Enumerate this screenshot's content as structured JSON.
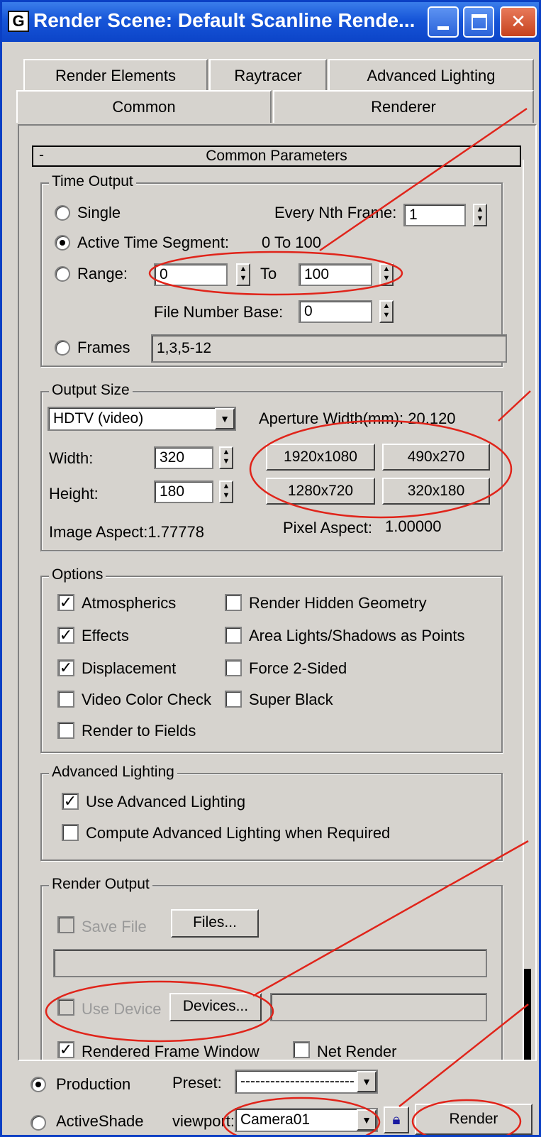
{
  "window": {
    "title": "Render Scene: Default Scanline Rende...",
    "app_icon": "3ds-max-icon"
  },
  "tabs_row1": [
    "Render Elements",
    "Raytracer",
    "Advanced Lighting"
  ],
  "tabs_row2": [
    "Common",
    "Renderer"
  ],
  "rollout": {
    "toggle": "-",
    "title": "Common Parameters"
  },
  "time_output": {
    "label": "Time Output",
    "single": "Single",
    "every_nth_label": "Every Nth Frame:",
    "every_nth_value": "1",
    "active_segment": "Active Time Segment:",
    "active_segment_value": "0 To 100",
    "range_label": "Range:",
    "range_from": "0",
    "to_label": "To",
    "range_to": "100",
    "file_number_base_label": "File Number Base:",
    "file_number_base": "0",
    "frames_label": "Frames",
    "frames_value": "1,3,5-12"
  },
  "output_size": {
    "label": "Output Size",
    "preset": "HDTV (video)",
    "aperture": "Aperture Width(mm): 20.120",
    "width_label": "Width:",
    "width": "320",
    "height_label": "Height:",
    "height": "180",
    "sizes": [
      "1920x1080",
      "490x270",
      "1280x720",
      "320x180"
    ],
    "image_aspect": "Image Aspect:1.77778",
    "pixel_aspect_label": "Pixel Aspect:",
    "pixel_aspect": "1.00000"
  },
  "options": {
    "label": "Options",
    "atmospherics": "Atmospherics",
    "effects": "Effects",
    "displacement": "Displacement",
    "video_color_check": "Video Color Check",
    "render_to_fields": "Render to Fields",
    "render_hidden": "Render Hidden Geometry",
    "area_lights": "Area Lights/Shadows as Points",
    "force_2sided": "Force 2-Sided",
    "super_black": "Super Black"
  },
  "advanced_lighting": {
    "label": "Advanced Lighting",
    "use": "Use Advanced Lighting",
    "compute": "Compute Advanced Lighting when Required"
  },
  "render_output": {
    "label": "Render Output",
    "save_file": "Save File",
    "files_button": "Files...",
    "use_device": "Use Device",
    "devices_button": "Devices...",
    "rendered_frame_window": "Rendered Frame Window",
    "net_render": "Net Render"
  },
  "bottom": {
    "production": "Production",
    "activeshade": "ActiveShade",
    "preset_label": "Preset:",
    "preset_value": "-----------------------",
    "viewport_label": "viewport:",
    "viewport_value": "Camera01",
    "render_button": "Render",
    "lock_icon": "lock-icon"
  },
  "colors": {
    "titlebar": "#1655d8",
    "dialog_bg": "#d6d3ce",
    "annotation": "#e0241a"
  }
}
